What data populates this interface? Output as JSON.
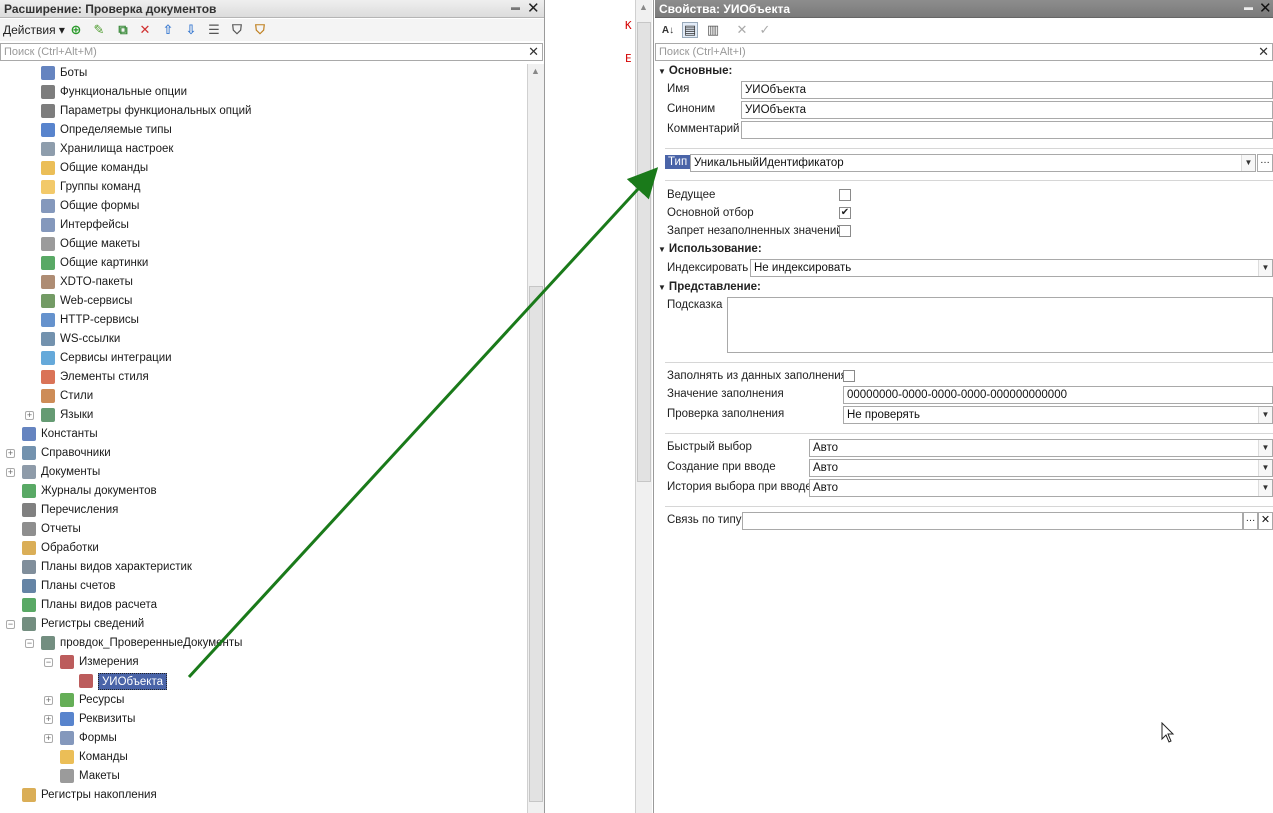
{
  "left": {
    "title": "Расширение: Проверка документов",
    "actions_label": "Действия",
    "search_placeholder": "Поиск (Ctrl+Alt+M)",
    "tree": [
      {
        "label": "Боты",
        "indent": 2,
        "icon": "bot-icon",
        "color": "#4a6fb5"
      },
      {
        "label": "Функциональные опции",
        "indent": 2,
        "icon": "functional-options-icon",
        "color": "#666666"
      },
      {
        "label": "Параметры функциональных опций",
        "indent": 2,
        "icon": "functional-option-params-icon",
        "color": "#666666"
      },
      {
        "label": "Определяемые типы",
        "indent": 2,
        "icon": "defined-types-icon",
        "color": "#3b6fc4"
      },
      {
        "label": "Хранилища настроек",
        "indent": 2,
        "icon": "settings-storage-icon",
        "color": "#7a8c9e"
      },
      {
        "label": "Общие команды",
        "indent": 2,
        "icon": "common-commands-icon",
        "color": "#e8b33a"
      },
      {
        "label": "Группы команд",
        "indent": 2,
        "icon": "command-groups-icon",
        "color": "#f0c050"
      },
      {
        "label": "Общие формы",
        "indent": 2,
        "icon": "common-forms-icon",
        "color": "#6f86b0"
      },
      {
        "label": "Интерфейсы",
        "indent": 2,
        "icon": "interfaces-icon",
        "color": "#6f86b0"
      },
      {
        "label": "Общие макеты",
        "indent": 2,
        "icon": "common-templates-icon",
        "color": "#8a8a8a"
      },
      {
        "label": "Общие картинки",
        "indent": 2,
        "icon": "common-pictures-icon",
        "color": "#3c9a4a"
      },
      {
        "label": "XDTO-пакеты",
        "indent": 2,
        "icon": "xdto-packages-icon",
        "color": "#a0785a"
      },
      {
        "label": "Web-сервисы",
        "indent": 2,
        "icon": "web-services-icon",
        "color": "#5a8a4a"
      },
      {
        "label": "HTTP-сервисы",
        "indent": 2,
        "icon": "http-services-icon",
        "color": "#4a7fc4"
      },
      {
        "label": "WS-ссылки",
        "indent": 2,
        "icon": "ws-links-icon",
        "color": "#5a7fa0"
      },
      {
        "label": "Сервисы интеграции",
        "indent": 2,
        "icon": "integration-services-icon",
        "color": "#4a9ad4"
      },
      {
        "label": "Элементы стиля",
        "indent": 2,
        "icon": "style-items-icon",
        "color": "#d45a3a"
      },
      {
        "label": "Стили",
        "indent": 2,
        "icon": "styles-icon",
        "color": "#c4783a"
      },
      {
        "label": "Языки",
        "indent": 2,
        "icon": "languages-icon",
        "color": "#4a8a5a",
        "expand": "+"
      },
      {
        "label": "Константы",
        "indent": 1,
        "icon": "constants-icon",
        "color": "#4a6fb5"
      },
      {
        "label": "Справочники",
        "indent": 1,
        "icon": "catalogs-icon",
        "color": "#5a7fa0",
        "expand": "+"
      },
      {
        "label": "Документы",
        "indent": 1,
        "icon": "documents-icon",
        "color": "#7a8a9a",
        "expand": "+"
      },
      {
        "label": "Журналы документов",
        "indent": 1,
        "icon": "document-journals-icon",
        "color": "#3c9a4a"
      },
      {
        "label": "Перечисления",
        "indent": 1,
        "icon": "enums-icon",
        "color": "#6a6a6a"
      },
      {
        "label": "Отчеты",
        "indent": 1,
        "icon": "reports-icon",
        "color": "#7a7a7a"
      },
      {
        "label": "Обработки",
        "indent": 1,
        "icon": "data-processors-icon",
        "color": "#d4a03a"
      },
      {
        "label": "Планы видов характеристик",
        "indent": 1,
        "icon": "chart-of-characteristic-types-icon",
        "color": "#6a7a8a"
      },
      {
        "label": "Планы счетов",
        "indent": 1,
        "icon": "chart-of-accounts-icon",
        "color": "#4a6f95"
      },
      {
        "label": "Планы видов расчета",
        "indent": 1,
        "icon": "chart-of-calculation-types-icon",
        "color": "#3c9a4a"
      },
      {
        "label": "Регистры сведений",
        "indent": 1,
        "icon": "information-registers-icon",
        "color": "#5a7a6a",
        "expand": "−"
      },
      {
        "label": "провдок_ПроверенныеДокументы",
        "indent": 2,
        "icon": "register-icon",
        "color": "#5a7a6a",
        "expand": "−"
      },
      {
        "label": "Измерения",
        "indent": 3,
        "icon": "dimensions-icon",
        "color": "#b04040",
        "expand": "−"
      },
      {
        "label": "УИОбъекта",
        "indent": 4,
        "icon": "dimension-icon",
        "color": "#b04040",
        "selected": true
      },
      {
        "label": "Ресурсы",
        "indent": 3,
        "icon": "resources-icon",
        "color": "#4aa03a",
        "expand": "+"
      },
      {
        "label": "Реквизиты",
        "indent": 3,
        "icon": "attributes-icon",
        "color": "#3b6fc4",
        "expand": "+"
      },
      {
        "label": "Формы",
        "indent": 3,
        "icon": "forms-icon",
        "color": "#6f86b0",
        "expand": "+"
      },
      {
        "label": "Команды",
        "indent": 3,
        "icon": "commands-icon",
        "color": "#e8b33a"
      },
      {
        "label": "Макеты",
        "indent": 3,
        "icon": "templates-icon",
        "color": "#8a8a8a"
      },
      {
        "label": "Регистры накопления",
        "indent": 1,
        "icon": "accumulation-registers-icon",
        "color": "#d4a03a"
      }
    ]
  },
  "mid": {
    "code_chars": [
      "К",
      "Е"
    ]
  },
  "right": {
    "title": "Свойства: УИОбъекта",
    "search_placeholder": "Поиск (Ctrl+Alt+I)",
    "section_main": "Основные:",
    "name_label": "Имя",
    "name_value": "УИОбъекта",
    "synonym_label": "Синоним",
    "synonym_value": "УИОбъекта",
    "comment_label": "Комментарий",
    "comment_value": "",
    "type_label": "Тип",
    "type_value": "УникальныйИдентификатор",
    "master_label": "Ведущее",
    "master_checked": false,
    "main_filter_label": "Основной отбор",
    "main_filter_checked": true,
    "deny_unfilled_label": "Запрет незаполненных значений",
    "deny_unfilled_checked": false,
    "section_usage": "Использование:",
    "index_label": "Индексировать",
    "index_value": "Не индексировать",
    "section_presentation": "Представление:",
    "tooltip_label": "Подсказка",
    "tooltip_value": "",
    "fill_from_label": "Заполнять из данных заполнения",
    "fill_from_checked": false,
    "fill_value_label": "Значение заполнения",
    "fill_value": "00000000-0000-0000-0000-000000000000",
    "fill_check_label": "Проверка заполнения",
    "fill_check_value": "Не проверять",
    "quick_choice_label": "Быстрый выбор",
    "quick_choice_value": "Авто",
    "create_on_input_label": "Создание при вводе",
    "create_on_input_value": "Авто",
    "choice_history_label": "История выбора при вводе",
    "choice_history_value": "Авто",
    "link_by_type_label": "Связь по типу",
    "link_by_type_value": ""
  },
  "colors": {
    "selection": "#4a64a8",
    "arrow": "#1a7a1a",
    "accent_text": "#d40000"
  }
}
